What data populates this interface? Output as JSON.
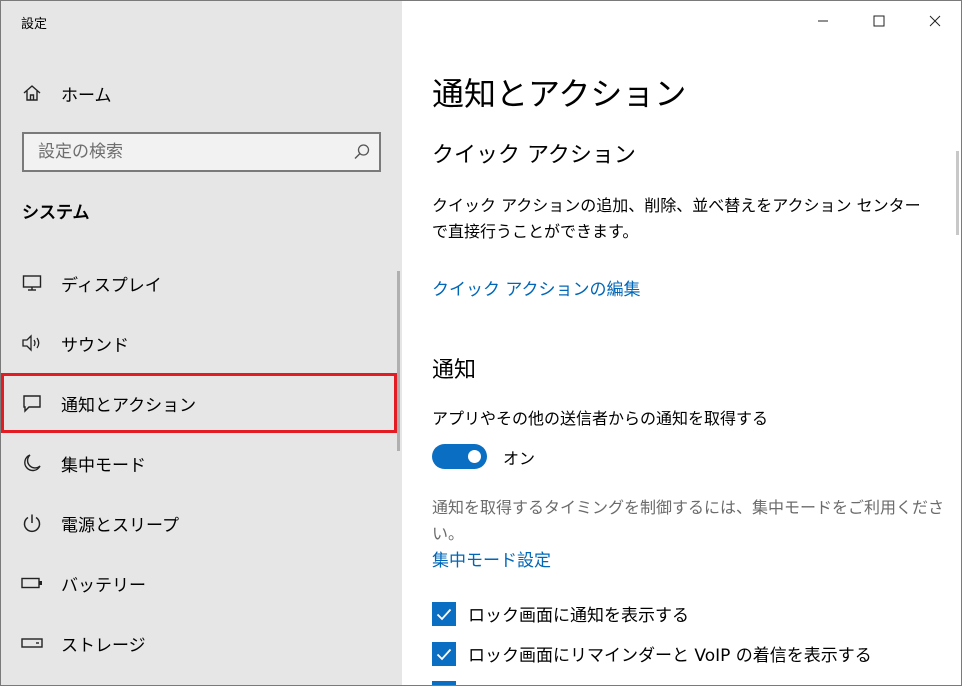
{
  "window": {
    "title": "設定",
    "controls": {
      "minimize_icon": "minimize-icon",
      "maximize_icon": "maximize-icon",
      "close_icon": "close-icon"
    }
  },
  "sidebar": {
    "home_label": "ホーム",
    "search": {
      "placeholder": "設定の検索",
      "value": ""
    },
    "section_title": "システム",
    "items": [
      {
        "label": "ディスプレイ",
        "icon": "monitor-icon"
      },
      {
        "label": "サウンド",
        "icon": "speaker-icon"
      },
      {
        "label": "通知とアクション",
        "icon": "notification-icon",
        "selected": true
      },
      {
        "label": "集中モード",
        "icon": "moon-icon"
      },
      {
        "label": "電源とスリープ",
        "icon": "power-icon"
      },
      {
        "label": "バッテリー",
        "icon": "battery-icon"
      },
      {
        "label": "ストレージ",
        "icon": "storage-icon"
      }
    ],
    "highlight_color": "#e31c23"
  },
  "main": {
    "page_title": "通知とアクション",
    "quick_actions": {
      "heading": "クイック アクション",
      "description": "クイック アクションの追加、削除、並べ替えをアクション センターで直接行うことができます。",
      "edit_link": "クイック アクションの編集"
    },
    "notifications": {
      "heading": "通知",
      "toggle_label_text": "アプリやその他の送信者からの通知を取得する",
      "toggle_state": "オン",
      "toggle_on": true,
      "focus_hint": "通知を取得するタイミングを制御するには、集中モードをご利用ください。",
      "focus_link": "集中モード設定",
      "checkboxes": [
        {
          "label": "ロック画面に通知を表示する",
          "checked": true
        },
        {
          "label": "ロック画面にリマインダーと VoIP の着信を表示する",
          "checked": true
        }
      ]
    },
    "accent_color": "#0a6fc2",
    "link_color": "#0067b8"
  }
}
